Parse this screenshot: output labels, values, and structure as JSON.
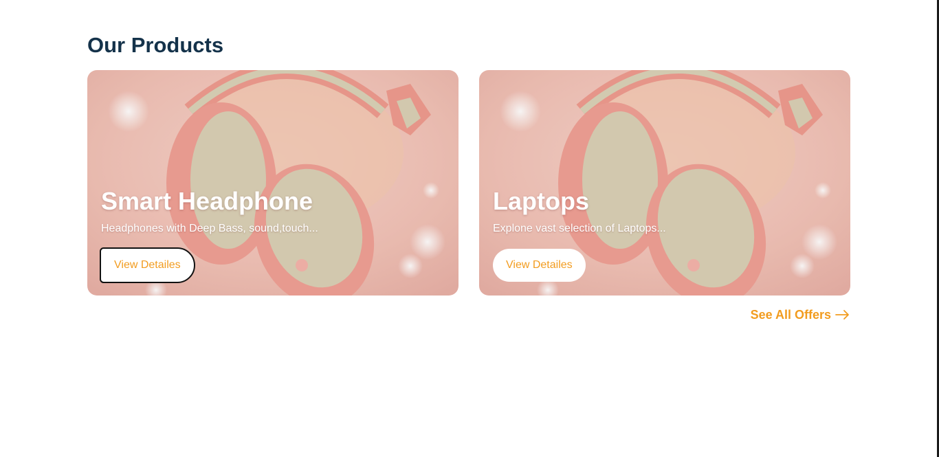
{
  "section": {
    "title": "Our Products"
  },
  "products": [
    {
      "title": "Smart Headphone",
      "description": "Headphones with Deep Bass, sound,touch...",
      "button_label": "View Detailes"
    },
    {
      "title": "Laptops",
      "description": "Explone vast selection of Laptops...",
      "button_label": "View Detailes"
    }
  ],
  "see_all": {
    "label": "See All Offers",
    "icon": "arrow-right-icon"
  },
  "colors": {
    "title": "#14324a",
    "accent": "#f29c1f",
    "card_bg": "#f3c3b8"
  }
}
